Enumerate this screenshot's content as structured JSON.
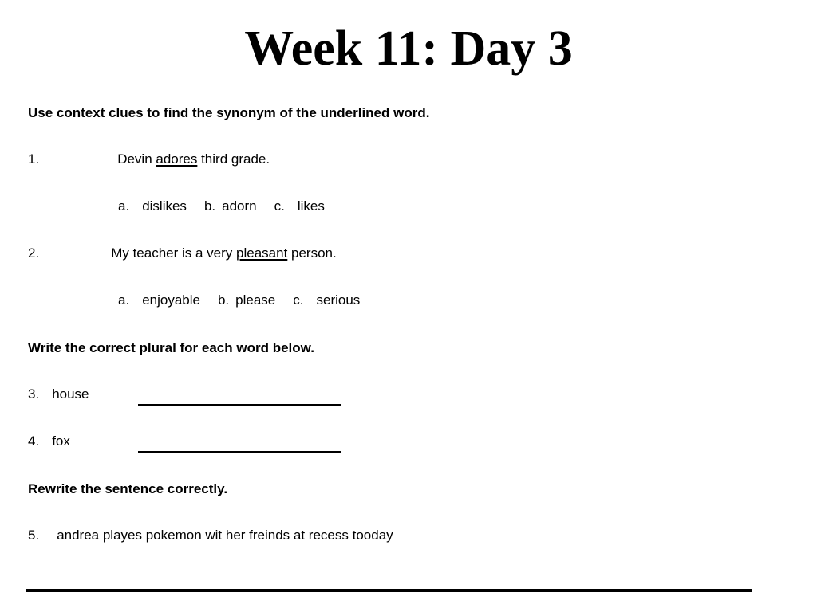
{
  "document": {
    "title": "Week 11: Day 3",
    "background_color": "#ffffff",
    "text_color": "#000000"
  },
  "sections": {
    "synonym": {
      "instruction": "Use context clues to find the synonym of the underlined word.",
      "questions": [
        {
          "number": "1.",
          "text_before": "Devin ",
          "underlined_word": "adores",
          "text_after": " third grade.",
          "choices_label_a": "a.",
          "choice_a": "dislikes",
          "choices_label_b": "b.",
          "choice_b": "adorn",
          "choices_label_c": "c.",
          "choice_c": "likes"
        },
        {
          "number": "2.",
          "text_before": "My teacher is a very ",
          "underlined_word": "pleasant",
          "text_after": " person.",
          "choices_label_a": "a.",
          "choice_a": "enjoyable",
          "choices_label_b": "b.",
          "choice_b": "please",
          "choices_label_c": "c.",
          "choice_c": "serious"
        }
      ]
    },
    "plural": {
      "instruction": "Write the correct plural for each word below.",
      "questions": [
        {
          "number": "3.",
          "word": "house",
          "answer": ""
        },
        {
          "number": "4.",
          "word": "fox",
          "answer": ""
        }
      ]
    },
    "rewrite": {
      "instruction": "Rewrite the sentence correctly.",
      "questions": [
        {
          "number": "5.",
          "sentence": "andrea playes pokemon wit her freinds at recess tooday"
        }
      ]
    }
  }
}
